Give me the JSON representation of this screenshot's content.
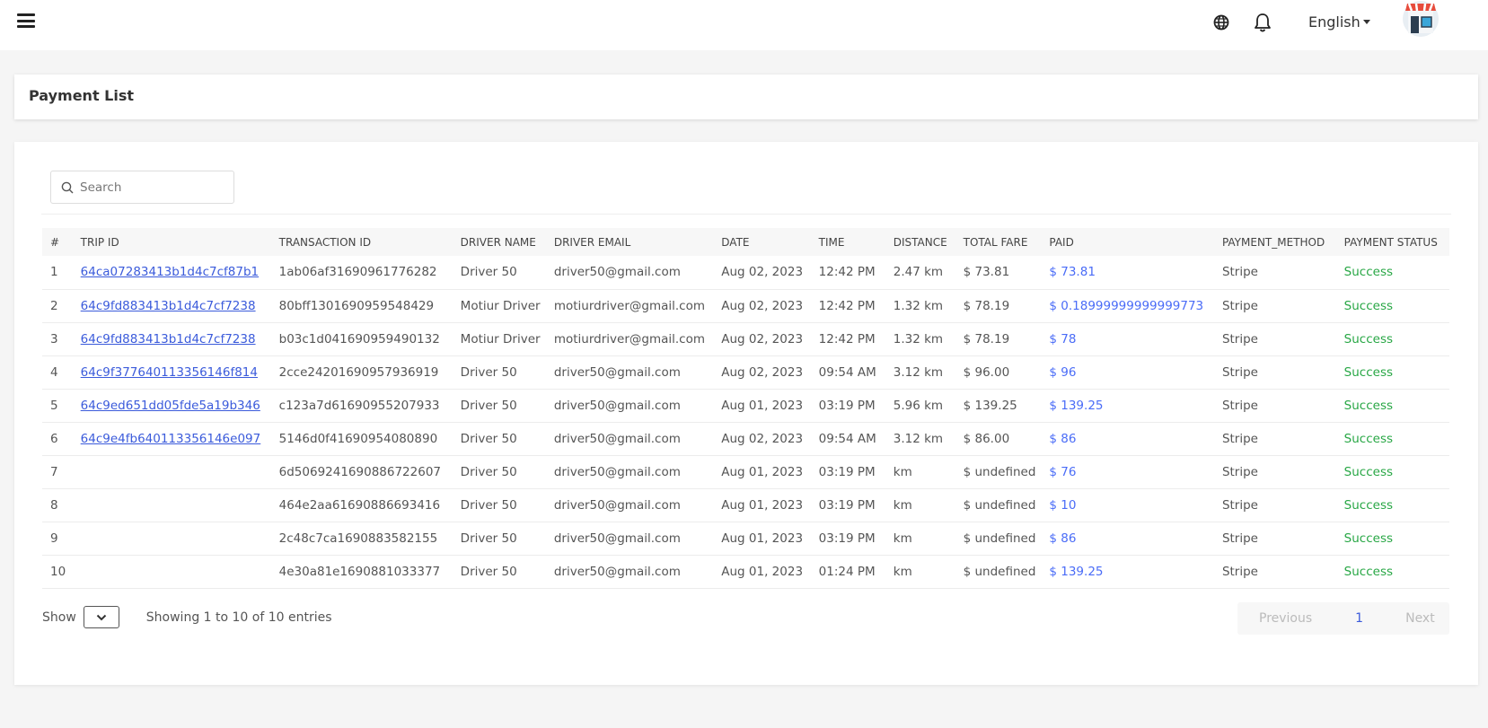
{
  "topbar": {
    "language": "English",
    "icons": {
      "menu": "hamburger-menu-icon",
      "globe": "globe-icon",
      "bell": "bell-icon"
    }
  },
  "page": {
    "title": "Payment List"
  },
  "search": {
    "placeholder": "Search",
    "value": ""
  },
  "table": {
    "headers": [
      "#",
      "TRIP ID",
      "TRANSACTION ID",
      "DRIVER NAME",
      "DRIVER EMAIL",
      "DATE",
      "TIME",
      "DISTANCE",
      "TOTAL FARE",
      "PAID",
      "PAYMENT_METHOD",
      "PAYMENT STATUS"
    ],
    "rows": [
      [
        "1",
        "64ca07283413b1d4c7cf87b1",
        "1ab06af31690961776282",
        "Driver 50",
        "driver50@gmail.com",
        "Aug 02, 2023",
        "12:42 PM",
        "2.47 km",
        "$ 73.81",
        "$ 73.81",
        "Stripe",
        "Success"
      ],
      [
        "2",
        "64c9fd883413b1d4c7cf7238",
        "80bff1301690959548429",
        "Motiur Driver",
        "motiurdriver@gmail.com",
        "Aug 02, 2023",
        "12:42 PM",
        "1.32 km",
        "$ 78.19",
        "$ 0.18999999999999773",
        "Stripe",
        "Success"
      ],
      [
        "3",
        "64c9fd883413b1d4c7cf7238",
        "b03c1d041690959490132",
        "Motiur Driver",
        "motiurdriver@gmail.com",
        "Aug 02, 2023",
        "12:42 PM",
        "1.32 km",
        "$ 78.19",
        "$ 78",
        "Stripe",
        "Success"
      ],
      [
        "4",
        "64c9f377640113356146f814",
        "2cce24201690957936919",
        "Driver 50",
        "driver50@gmail.com",
        "Aug 02, 2023",
        "09:54 AM",
        "3.12 km",
        "$ 96.00",
        "$ 96",
        "Stripe",
        "Success"
      ],
      [
        "5",
        "64c9ed651dd05fde5a19b346",
        "c123a7d61690955207933",
        "Driver 50",
        "driver50@gmail.com",
        "Aug 01, 2023",
        "03:19 PM",
        "5.96 km",
        "$ 139.25",
        "$ 139.25",
        "Stripe",
        "Success"
      ],
      [
        "6",
        "64c9e4fb640113356146e097",
        "5146d0f41690954080890",
        "Driver 50",
        "driver50@gmail.com",
        "Aug 02, 2023",
        "09:54 AM",
        "3.12 km",
        "$ 86.00",
        "$ 86",
        "Stripe",
        "Success"
      ],
      [
        "7",
        "",
        "6d5069241690886722607",
        "Driver 50",
        "driver50@gmail.com",
        "Aug 01, 2023",
        "03:19 PM",
        "km",
        "$ undefined",
        "$ 76",
        "Stripe",
        "Success"
      ],
      [
        "8",
        "",
        "464e2aa61690886693416",
        "Driver 50",
        "driver50@gmail.com",
        "Aug 01, 2023",
        "03:19 PM",
        "km",
        "$ undefined",
        "$ 10",
        "Stripe",
        "Success"
      ],
      [
        "9",
        "",
        "2c48c7ca1690883582155",
        "Driver 50",
        "driver50@gmail.com",
        "Aug 01, 2023",
        "03:19 PM",
        "km",
        "$ undefined",
        "$ 86",
        "Stripe",
        "Success"
      ],
      [
        "10",
        "",
        "4e30a81e1690881033377",
        "Driver 50",
        "driver50@gmail.com",
        "Aug 01, 2023",
        "01:24 PM",
        "km",
        "$ undefined",
        "$ 139.25",
        "Stripe",
        "Success"
      ]
    ]
  },
  "footer": {
    "show_label": "Show",
    "entries_text": "Showing 1 to 10 of 10 entries",
    "pagination": {
      "previous": "Previous",
      "current": "1",
      "next": "Next"
    }
  },
  "colors": {
    "link": "#3b5bdb",
    "paid": "#4a6cf7",
    "success": "#28a745"
  }
}
